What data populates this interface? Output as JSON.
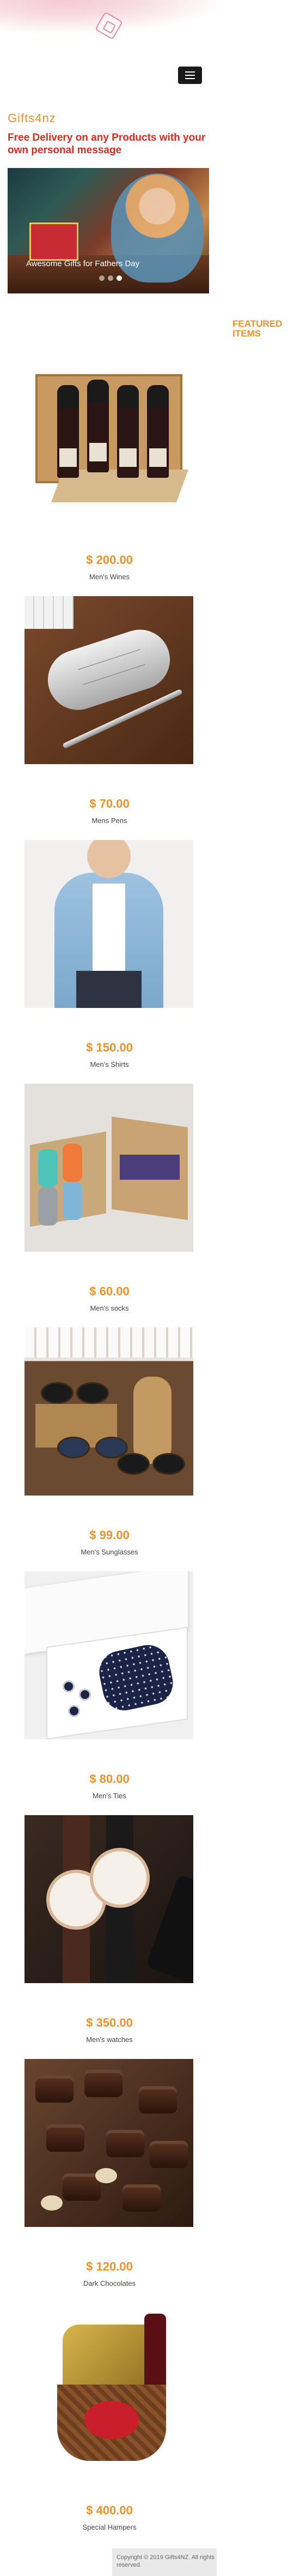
{
  "header": {
    "brand": "Gifts4nz",
    "tagline": "Free Delivery on any Products with your own personal message"
  },
  "hero": {
    "caption": "Awesome Gifts for Fathers Day"
  },
  "section": {
    "title": "FEATURED ITEMS"
  },
  "products": [
    {
      "price": "$ 200.00",
      "name": "Men's Wines"
    },
    {
      "price": "$ 70.00",
      "name": "Mens Pens"
    },
    {
      "price": "$ 150.00",
      "name": "Men's Shirts"
    },
    {
      "price": "$ 60.00",
      "name": "Men's socks"
    },
    {
      "price": "$ 99.00",
      "name": "Men's Sunglasses"
    },
    {
      "price": "$ 80.00",
      "name": "Men's Ties"
    },
    {
      "price": "$ 350.00",
      "name": "Men's watches"
    },
    {
      "price": "$ 120.00",
      "name": "Dark Chocolates"
    },
    {
      "price": "$ 400.00",
      "name": "Special Hampers"
    }
  ],
  "footer": {
    "copyright": "Copyright © 2019 Gifts4NZ. All rights reserved."
  },
  "colors": {
    "accent": "#f0932b",
    "tagline": "#e02b20"
  }
}
